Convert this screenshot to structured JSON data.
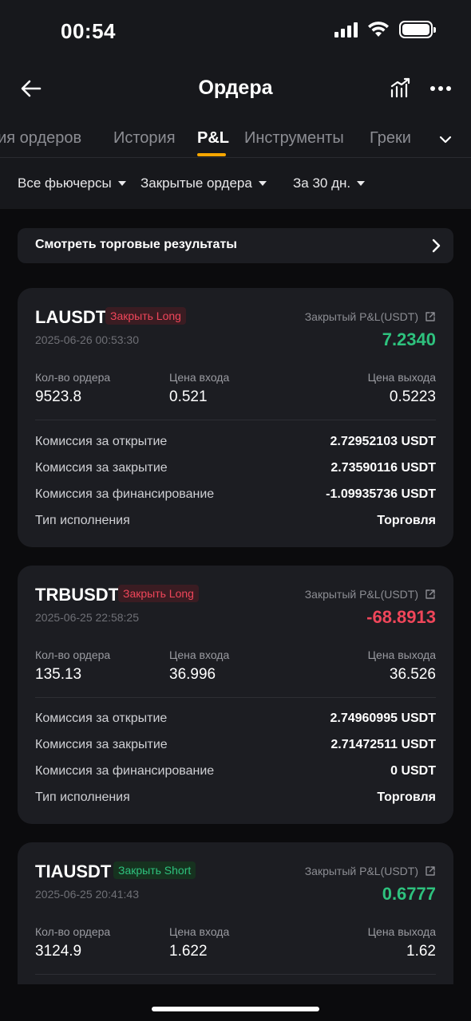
{
  "status_bar": {
    "time": "00:54"
  },
  "nav": {
    "title": "Ордера"
  },
  "tabs": [
    {
      "label": "рия ордеров"
    },
    {
      "label": "История"
    },
    {
      "label": "P&L"
    },
    {
      "label": "Инструменты"
    },
    {
      "label": "Греки"
    }
  ],
  "active_tab": "P&L",
  "filters": [
    {
      "label": "Все фьючерсы"
    },
    {
      "label": "Закрытые ордера"
    },
    {
      "label": "За 30 дн."
    }
  ],
  "results_link": {
    "label": "Смотреть торговые результаты"
  },
  "colors": {
    "accent": "#f7a600",
    "profit": "#2ec27e",
    "loss": "#f0465a",
    "card": "#1c1d22",
    "background": "#0b0b0d"
  },
  "orders": [
    {
      "symbol": "LAUSDT",
      "badge": "Закрыть Long",
      "datetime": "2025-06-26 00:53:30",
      "pnl_label": "Закрытый P&L(USDT)",
      "pnl": "7.2340",
      "qty_label": "Кол-во ордера",
      "qty": "9523.8",
      "entry_label": "Цена входа",
      "entry": "0.521",
      "exit_label": "Цена выхода",
      "exit": "0.5223",
      "fees": [
        {
          "label": "Комиссия за открытие",
          "value": "2.72952103 USDT"
        },
        {
          "label": "Комиссия за закрытие",
          "value": "2.73590116 USDT"
        },
        {
          "label": "Комиссия за финансирование",
          "value": "-1.09935736 USDT"
        },
        {
          "label": "Тип исполнения",
          "value": "Торговля"
        }
      ]
    },
    {
      "symbol": "TRBUSDT",
      "badge": "Закрыть Long",
      "datetime": "2025-06-25 22:58:25",
      "pnl_label": "Закрытый P&L(USDT)",
      "pnl": "-68.8913",
      "qty_label": "Кол-во ордера",
      "qty": "135.13",
      "entry_label": "Цена входа",
      "entry": "36.996",
      "exit_label": "Цена выхода",
      "exit": "36.526",
      "fees": [
        {
          "label": "Комиссия за открытие",
          "value": "2.74960995 USDT"
        },
        {
          "label": "Комиссия за закрытие",
          "value": "2.71472511 USDT"
        },
        {
          "label": "Комиссия за финансирование",
          "value": "0 USDT"
        },
        {
          "label": "Тип исполнения",
          "value": "Торговля"
        }
      ]
    },
    {
      "symbol": "TIAUSDT",
      "badge": "Закрыть Short",
      "datetime": "2025-06-25 20:41:43",
      "pnl_label": "Закрытый P&L(USDT)",
      "pnl": "0.6777",
      "qty_label": "Кол-во ордера",
      "qty": "3124.9",
      "entry_label": "Цена входа",
      "entry": "1.622",
      "exit_label": "Цена выхода",
      "exit": "1.62"
    }
  ]
}
